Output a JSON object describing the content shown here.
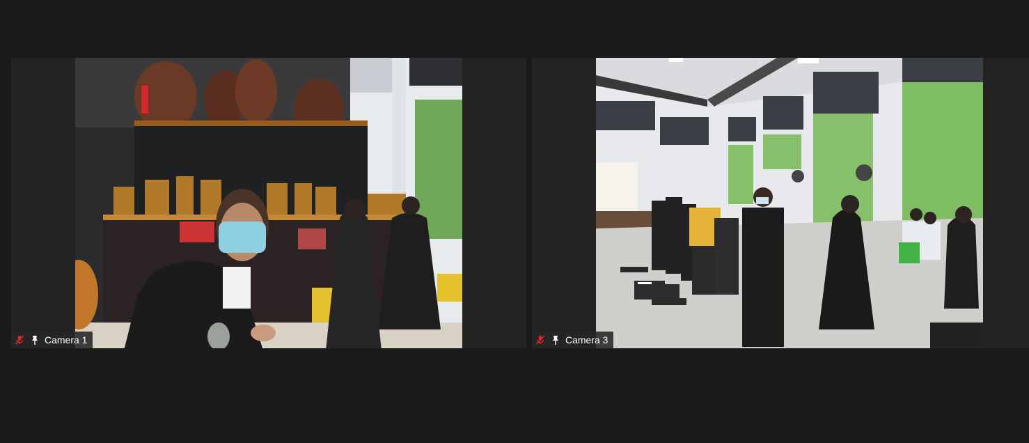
{
  "participants": [
    {
      "label": "Camera 1",
      "mic_icon": "mic-muted-icon",
      "pin_icon": "pin-icon",
      "muted_color": "#e02828"
    },
    {
      "label": "Camera 3",
      "mic_icon": "mic-muted-icon",
      "pin_icon": "pin-icon",
      "muted_color": "#e02828"
    }
  ]
}
